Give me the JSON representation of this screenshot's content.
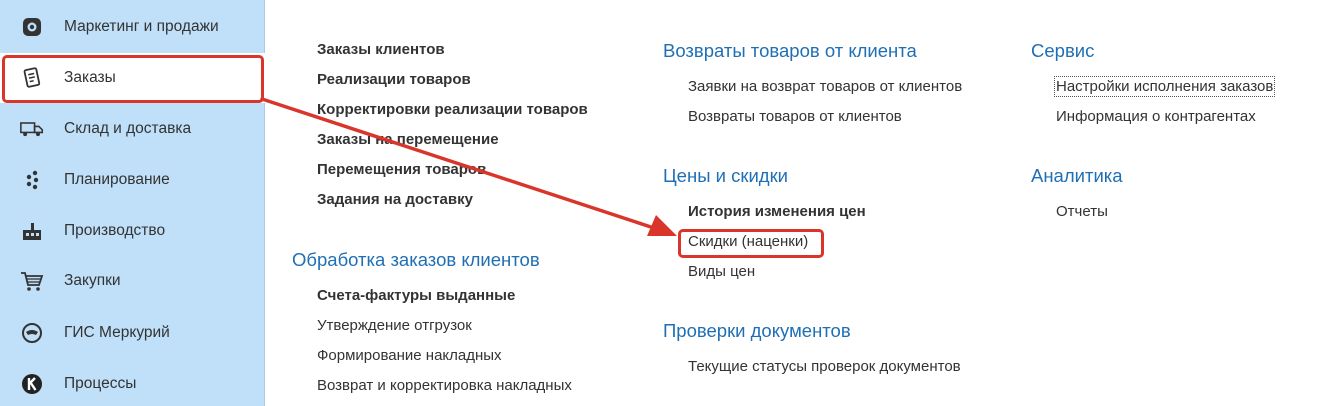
{
  "sidebar": {
    "items": [
      {
        "label": "Маркетинг и продажи",
        "icon": "target-icon"
      },
      {
        "label": "Заказы",
        "icon": "document-icon"
      },
      {
        "label": "Склад и доставка",
        "icon": "truck-icon"
      },
      {
        "label": "Планирование",
        "icon": "dots-icon"
      },
      {
        "label": "Производство",
        "icon": "factory-icon"
      },
      {
        "label": "Закупки",
        "icon": "cart-icon"
      },
      {
        "label": "ГИС Меркурий",
        "icon": "mercury-icon"
      },
      {
        "label": "Процессы",
        "icon": "k-circle-icon"
      }
    ],
    "active_index": 1
  },
  "col1": {
    "links": [
      "Заказы клиентов",
      "Реализации товаров",
      "Корректировки реализации товаров",
      "Заказы на перемещение",
      "Перемещения товаров",
      "Задания на доставку"
    ],
    "section2_title": "Обработка заказов клиентов",
    "section2_links": [
      "Счета-фактуры выданные",
      "Утверждение отгрузок",
      "Формирование накладных",
      "Возврат и корректировка накладных"
    ]
  },
  "col2": {
    "section1_title": "Возвраты товаров от клиента",
    "section1_links": [
      "Заявки на возврат товаров от клиентов",
      "Возвраты товаров от клиентов"
    ],
    "section2_title": "Цены и скидки",
    "section2_links": [
      "История изменения цен",
      "Скидки (наценки)",
      "Виды цен"
    ],
    "section3_title": "Проверки документов",
    "section3_links": [
      "Текущие статусы проверок документов"
    ]
  },
  "col3": {
    "section1_title": "Сервис",
    "section1_links": [
      "Настройки исполнения заказов",
      "Информация о контрагентах"
    ],
    "section2_title": "Аналитика",
    "section2_links": [
      "Отчеты"
    ]
  },
  "colors": {
    "sidebar_bg": "#bfe0f8",
    "section_title": "#1f6fb5",
    "highlight": "#d9352b"
  }
}
